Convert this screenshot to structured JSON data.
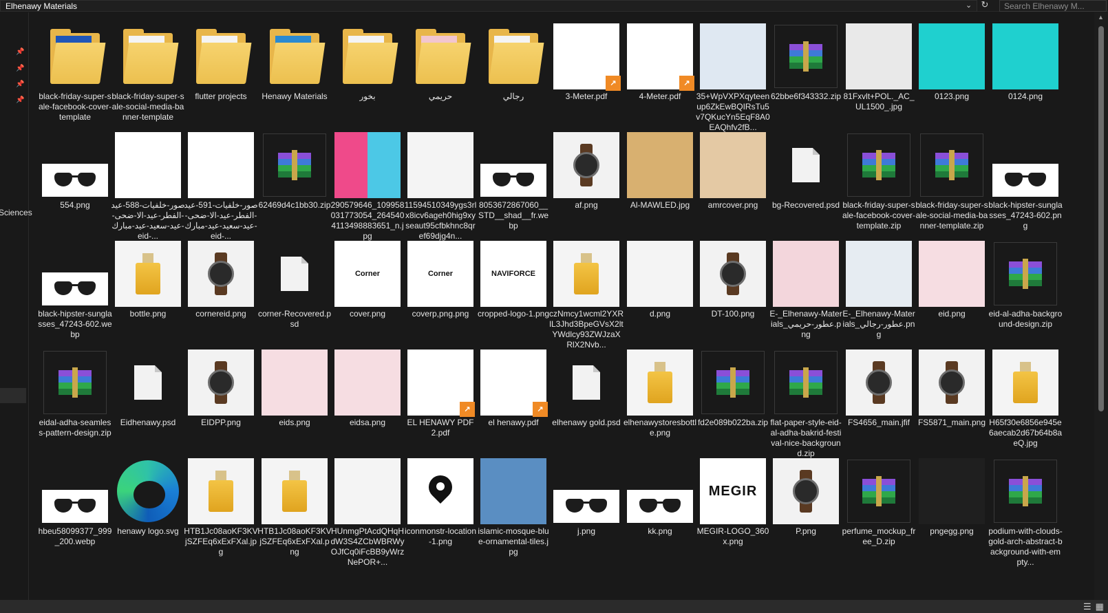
{
  "window": {
    "breadcrumb": "Elhenawy Materials",
    "search_placeholder": "Search Elhenawy M..."
  },
  "nav": {
    "visible_label": "Sciences"
  },
  "files": [
    {
      "name": "black-friday-super-sale-facebook-cover-template",
      "kind": "folder"
    },
    {
      "name": "black-friday-super-sale-social-media-banner-template",
      "kind": "folder"
    },
    {
      "name": "flutter projects",
      "kind": "folder"
    },
    {
      "name": "Henawy Materials",
      "kind": "folder"
    },
    {
      "name": "بخور",
      "kind": "folder"
    },
    {
      "name": "حريمي",
      "kind": "folder"
    },
    {
      "name": "رجالي",
      "kind": "folder"
    },
    {
      "name": "3-Meter.pdf",
      "kind": "pdf"
    },
    {
      "name": "4-Meter.pdf",
      "kind": "pdf"
    },
    {
      "name": "35+WpVXPXqyteenup6ZkEwBQIRsTu5v7QKucYn5EqF8A0EAQhfv2fB...",
      "kind": "image"
    },
    {
      "name": "62bbe6f343332.zip",
      "kind": "zip"
    },
    {
      "name": "81Fxvlt+POL._AC_UL1500_.jpg",
      "kind": "image"
    },
    {
      "name": "0123.png",
      "kind": "image"
    },
    {
      "name": "0124.png",
      "kind": "image"
    },
    {
      "name": "554.png",
      "kind": "sunglasses"
    },
    {
      "name": "صور-خلفيات-588-عيد-الفطر-عيد-الا-ضحى-عيد-سعيد-عيد-مبارك-eid-...",
      "kind": "image"
    },
    {
      "name": "صور-خلفيات-591-عيد-الفطر-عيد-الا-ضحى-عيد-سعيد-عيد-مبارك-eid-...",
      "kind": "image"
    },
    {
      "name": "62469d4c1bb30.zip",
      "kind": "zip"
    },
    {
      "name": "290579646_109958031773054_2645404113498883651_n.jpg",
      "kind": "image"
    },
    {
      "name": "11594510349ygs3rlx8icv6ageh0hig9xyseaut95cfbkhnc8qref69djg4n...",
      "kind": "image"
    },
    {
      "name": "8053672867060__STD__shad__fr.webp",
      "kind": "sunglasses"
    },
    {
      "name": "af.png",
      "kind": "watch"
    },
    {
      "name": "Al-MAWLED.jpg",
      "kind": "image"
    },
    {
      "name": "amrcover.png",
      "kind": "image"
    },
    {
      "name": "bg-Recovered.psd",
      "kind": "doc"
    },
    {
      "name": "black-friday-super-sale-facebook-cover-template.zip",
      "kind": "zip"
    },
    {
      "name": "black-friday-super-sale-social-media-banner-template.zip",
      "kind": "zip"
    },
    {
      "name": "black-hipster-sunglasses_47243-602.png",
      "kind": "sunglasses"
    },
    {
      "name": "black-hipster-sunglasses_47243-602.webp",
      "kind": "sunglasses"
    },
    {
      "name": "bottle.png",
      "kind": "bottle"
    },
    {
      "name": "cornereid.png",
      "kind": "watch"
    },
    {
      "name": "corner-Recovered.psd",
      "kind": "doc"
    },
    {
      "name": "cover.png",
      "kind": "text",
      "text": "Corner"
    },
    {
      "name": "coverp,png.png",
      "kind": "text",
      "text": "Corner"
    },
    {
      "name": "cropped-logo-1.png",
      "kind": "text",
      "text": "NAVIFORCE"
    },
    {
      "name": "czNmcy1wcml2YXRlL3Jhd3BpeGVsX2ltYWdlcy93ZWJzaXRlX2Nvb...",
      "kind": "bottle"
    },
    {
      "name": "d.png",
      "kind": "image"
    },
    {
      "name": "DT-100.png",
      "kind": "watch"
    },
    {
      "name": "E-_Elhenawy-Materials_عطور-حريمي.png",
      "kind": "image"
    },
    {
      "name": "E-_Elhenawy-Materials_عطور-رجالي.png",
      "kind": "image"
    },
    {
      "name": "eid.png",
      "kind": "image"
    },
    {
      "name": "eid-al-adha-background-design.zip",
      "kind": "zip"
    },
    {
      "name": "eidal-adha-seamless-pattern-design.zip",
      "kind": "zip"
    },
    {
      "name": "Eidhenawy.psd",
      "kind": "doc"
    },
    {
      "name": "EIDPP.png",
      "kind": "watch"
    },
    {
      "name": "eids.png",
      "kind": "image"
    },
    {
      "name": "eidsa.png",
      "kind": "image"
    },
    {
      "name": "EL HENAWY PDF 2.pdf",
      "kind": "pdf"
    },
    {
      "name": "el henawy.pdf",
      "kind": "pdf"
    },
    {
      "name": "elhenawy gold.psd",
      "kind": "doc"
    },
    {
      "name": "elhenawystoresbottle.png",
      "kind": "bottle"
    },
    {
      "name": "fd2e089b022ba.zip",
      "kind": "zip"
    },
    {
      "name": "flat-paper-style-eid-al-adha-bakrid-festival-nice-background.zip",
      "kind": "zip"
    },
    {
      "name": "FS4656_main.jfif",
      "kind": "watch"
    },
    {
      "name": "FS5871_main.png",
      "kind": "watch"
    },
    {
      "name": "H65f30e6856e945e6aecab2d67b64b8aeQ.jpg",
      "kind": "bottle"
    },
    {
      "name": "hbeu58099377_999_200.webp",
      "kind": "sunglasses"
    },
    {
      "name": "henawy logo.svg",
      "kind": "edge"
    },
    {
      "name": "HTB1Jc08aoKF3KVjSZFEq6xExFXal.jpg",
      "kind": "bottle"
    },
    {
      "name": "HTB1Jc08aoKF3KVjSZFEq6xExFXal.png",
      "kind": "bottle"
    },
    {
      "name": "HUnmgPtAcdQHqHdW3S4ZCbWBRWyOJfCq0iFcBB9yWrzNePOR+...",
      "kind": "image"
    },
    {
      "name": "iconmonstr-location-1.png",
      "kind": "location"
    },
    {
      "name": "islamic-mosque-blue-ornamental-tiles.jpg",
      "kind": "image"
    },
    {
      "name": "j.png",
      "kind": "sunglasses"
    },
    {
      "name": "kk.png",
      "kind": "sunglasses"
    },
    {
      "name": "MEGIR-LOGO_360x.png",
      "kind": "text",
      "text": "MEGIR"
    },
    {
      "name": "P.png",
      "kind": "watch"
    },
    {
      "name": "perfume_mockup_free_D.zip",
      "kind": "zip"
    },
    {
      "name": "pngegg.png",
      "kind": "image"
    },
    {
      "name": "podium-with-clouds-gold-arch-abstract-background-with-empty...",
      "kind": "zip"
    }
  ],
  "colors": {
    "folder": "#e8b64a",
    "pdf_badge": "#f08a25",
    "background": "#191919"
  }
}
